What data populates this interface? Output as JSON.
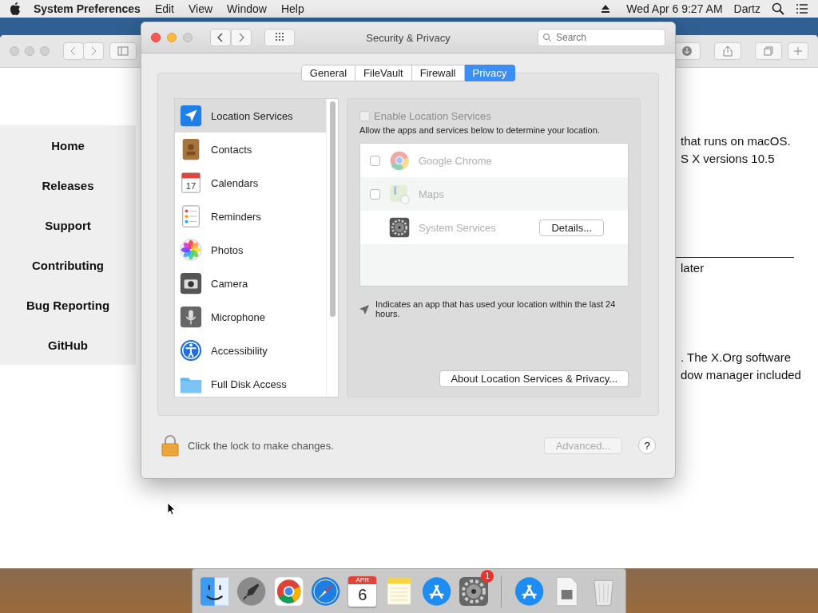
{
  "menu_bar": {
    "app_name": "System Preferences",
    "menus": [
      "Edit",
      "View",
      "Window",
      "Help"
    ],
    "clock": "Wed Apr 6  9:27 AM",
    "user": "Dartz"
  },
  "browser": {
    "sidebar": {
      "items": [
        "Home",
        "Releases",
        "Support",
        "Contributing",
        "Bug Reporting",
        "GitHub"
      ]
    },
    "content_lines": [
      {
        "kind": "text",
        "text": "that runs on macOS."
      },
      {
        "kind": "text",
        "text": "S X versions 10.5"
      },
      {
        "kind": "rule"
      },
      {
        "kind": "text",
        "text": "later"
      },
      {
        "kind": "text",
        "text": ". The X.Org software"
      },
      {
        "kind": "text",
        "text": "dow manager included"
      }
    ]
  },
  "dialog": {
    "title": "Security & Privacy",
    "search": {
      "placeholder": "Search"
    },
    "tabs": [
      {
        "label": "General",
        "selected": false
      },
      {
        "label": "FileVault",
        "selected": false
      },
      {
        "label": "Firewall",
        "selected": false
      },
      {
        "label": "Privacy",
        "selected": true
      }
    ],
    "categories": [
      {
        "kind": "location",
        "label": "Location Services",
        "selected": true
      },
      {
        "kind": "contacts",
        "label": "Contacts",
        "selected": false
      },
      {
        "kind": "calendar",
        "label": "Calendars",
        "selected": false,
        "icon_text": "17"
      },
      {
        "kind": "reminders",
        "label": "Reminders",
        "selected": false
      },
      {
        "kind": "photos",
        "label": "Photos",
        "selected": false
      },
      {
        "kind": "camera",
        "label": "Camera",
        "selected": false
      },
      {
        "kind": "microphone",
        "label": "Microphone",
        "selected": false
      },
      {
        "kind": "accessibility",
        "label": "Accessibility",
        "selected": false
      },
      {
        "kind": "folder",
        "label": "Full Disk Access",
        "selected": false
      }
    ],
    "enable": {
      "label": "Enable Location Services",
      "checked": false,
      "disabled": true
    },
    "description": "Allow the apps and services below to determine your location.",
    "apps": [
      {
        "kind": "checkbox",
        "name": "Google Chrome",
        "checked": false
      },
      {
        "kind": "checkbox",
        "name": "Maps",
        "checked": false
      },
      {
        "kind": "details",
        "name": "System Services",
        "button": "Details..."
      }
    ],
    "note": "Indicates an app that has used your location within the last 24 hours.",
    "about_button": "About Location Services & Privacy...",
    "lock_text": "Click the lock to make changes.",
    "advanced_button": {
      "label": "Advanced...",
      "disabled": true
    },
    "help_button": "?"
  },
  "dock": {
    "items": [
      {
        "kind": "finder"
      },
      {
        "kind": "rocket"
      },
      {
        "kind": "chrome"
      },
      {
        "kind": "compass"
      },
      {
        "kind": "calendar",
        "month": "APR",
        "day": "6"
      },
      {
        "kind": "notes"
      },
      {
        "kind": "appstore"
      },
      {
        "kind": "gear",
        "badge": "1"
      },
      {
        "kind": "separator"
      },
      {
        "kind": "appstore"
      },
      {
        "kind": "document"
      },
      {
        "kind": "trash"
      }
    ]
  }
}
